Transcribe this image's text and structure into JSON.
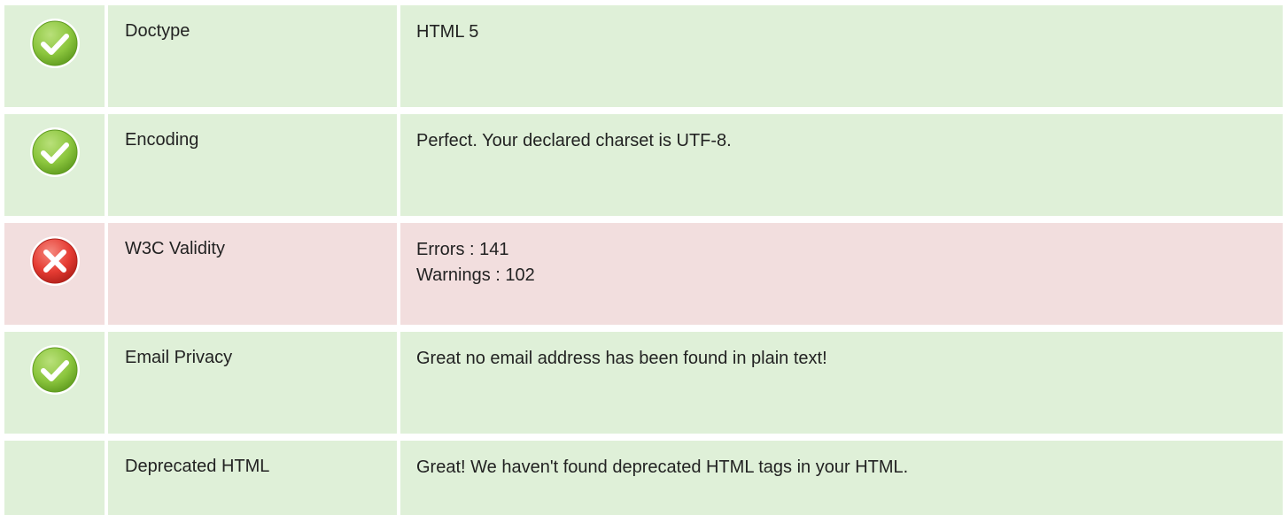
{
  "rows": [
    {
      "status": "pass",
      "icon": "check-circle-icon",
      "label": "Doctype",
      "lines": [
        "HTML 5"
      ]
    },
    {
      "status": "pass",
      "icon": "check-circle-icon",
      "label": "Encoding",
      "lines": [
        "Perfect. Your declared charset is UTF-8."
      ]
    },
    {
      "status": "fail",
      "icon": "x-circle-icon",
      "label": "W3C Validity",
      "lines": [
        "Errors : 141",
        "Warnings : 102"
      ]
    },
    {
      "status": "pass",
      "icon": "check-circle-icon",
      "label": "Email Privacy",
      "lines": [
        "Great no email address has been found in plain text!"
      ]
    },
    {
      "status": "neutral",
      "icon": "",
      "label": "Deprecated HTML",
      "lines": [
        "Great! We haven't found deprecated HTML tags in your HTML."
      ]
    }
  ],
  "colors": {
    "pass_bg": "#dff0d8",
    "fail_bg": "#f2dede",
    "pass_icon": "#8cc63e",
    "fail_icon": "#e53b32"
  }
}
